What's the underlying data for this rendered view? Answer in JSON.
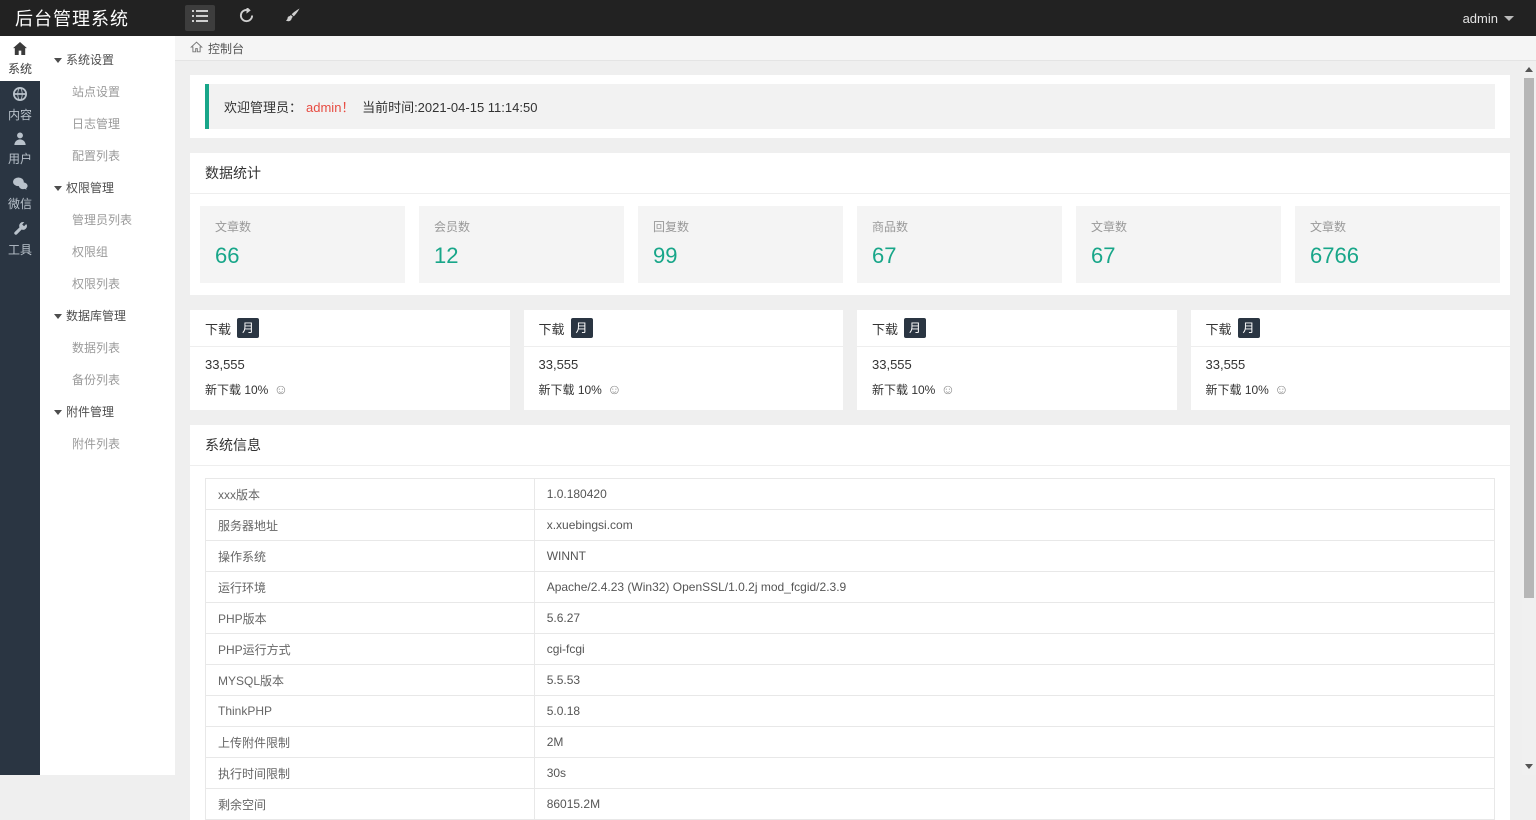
{
  "colors": {
    "accent": "#18a689",
    "danger": "#e74c42",
    "rail_bg": "#2a3542",
    "topbar_bg": "#222222"
  },
  "topbar": {
    "title": "后台管理系统",
    "user": "admin"
  },
  "rail": {
    "items": [
      {
        "label": "系统"
      },
      {
        "label": "内容"
      },
      {
        "label": "用户"
      },
      {
        "label": "微信"
      },
      {
        "label": "工具"
      }
    ]
  },
  "sidebar": {
    "items": [
      {
        "label": "系统设置",
        "type": "group"
      },
      {
        "label": "站点设置",
        "type": "child"
      },
      {
        "label": "日志管理",
        "type": "child"
      },
      {
        "label": "配置列表",
        "type": "child"
      },
      {
        "label": "权限管理",
        "type": "group"
      },
      {
        "label": "管理员列表",
        "type": "child"
      },
      {
        "label": "权限组",
        "type": "child"
      },
      {
        "label": "权限列表",
        "type": "child"
      },
      {
        "label": "数据库管理",
        "type": "group"
      },
      {
        "label": "数据列表",
        "type": "child"
      },
      {
        "label": "备份列表",
        "type": "child"
      },
      {
        "label": "附件管理",
        "type": "group"
      },
      {
        "label": "附件列表",
        "type": "child"
      }
    ]
  },
  "breadcrumb": {
    "label": "控制台"
  },
  "welcome": {
    "prefix": "欢迎管理员：",
    "name": "admin！",
    "time": "当前时间:2021-04-15 11:14:50"
  },
  "stats": {
    "title": "数据统计",
    "items": [
      {
        "label": "文章数",
        "value": "66"
      },
      {
        "label": "会员数",
        "value": "12"
      },
      {
        "label": "回复数",
        "value": "99"
      },
      {
        "label": "商品数",
        "value": "67"
      },
      {
        "label": "文章数",
        "value": "67"
      },
      {
        "label": "文章数",
        "value": "6766"
      }
    ]
  },
  "downloads": {
    "cards": [
      {
        "title": "下载",
        "badge": "月",
        "value": "33,555",
        "sub": "新下载 10%",
        "smiley": "☺"
      },
      {
        "title": "下载",
        "badge": "月",
        "value": "33,555",
        "sub": "新下载 10%",
        "smiley": "☺"
      },
      {
        "title": "下载",
        "badge": "月",
        "value": "33,555",
        "sub": "新下载 10%",
        "smiley": "☺"
      },
      {
        "title": "下载",
        "badge": "月",
        "value": "33,555",
        "sub": "新下载 10%",
        "smiley": "☺"
      }
    ]
  },
  "sysinfo": {
    "title": "系统信息",
    "rows": [
      {
        "label": "xxx版本",
        "value": "1.0.180420"
      },
      {
        "label": "服务器地址",
        "value": "x.xuebingsi.com"
      },
      {
        "label": "操作系统",
        "value": "WINNT"
      },
      {
        "label": "运行环境",
        "value": "Apache/2.4.23 (Win32) OpenSSL/1.0.2j mod_fcgid/2.3.9"
      },
      {
        "label": "PHP版本",
        "value": "5.6.27"
      },
      {
        "label": "PHP运行方式",
        "value": "cgi-fcgi"
      },
      {
        "label": "MYSQL版本",
        "value": "5.5.53"
      },
      {
        "label": "ThinkPHP",
        "value": "5.0.18"
      },
      {
        "label": "上传附件限制",
        "value": "2M"
      },
      {
        "label": "执行时间限制",
        "value": "30s"
      },
      {
        "label": "剩余空间",
        "value": "86015.2M"
      }
    ]
  }
}
